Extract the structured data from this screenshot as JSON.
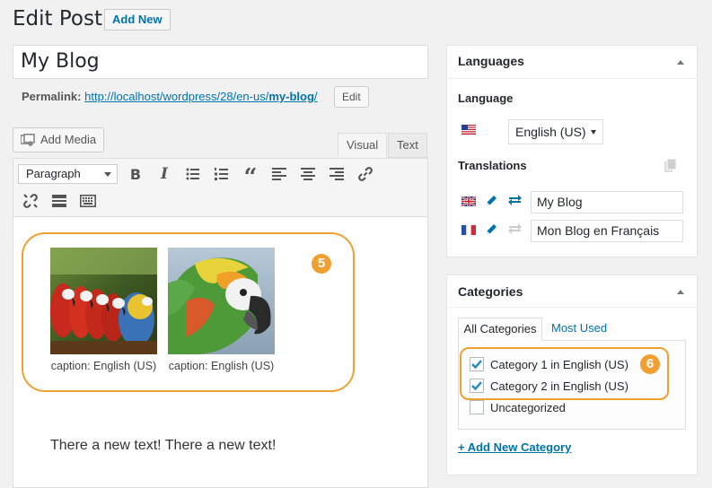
{
  "header": {
    "title": "Edit Post",
    "add_new_label": "Add New"
  },
  "post": {
    "title_value": "My Blog",
    "permalink_label": "Permalink:",
    "permalink_url_prefix": "http://localhost/wordpress/28/en-us/",
    "permalink_slug": "my-blog",
    "permalink_url_suffix": "/",
    "edit_label": "Edit"
  },
  "editor": {
    "add_media_label": "Add Media",
    "tabs": [
      {
        "label": "Visual",
        "active": true
      },
      {
        "label": "Text",
        "active": false
      }
    ],
    "format_select": "Paragraph",
    "toolbar_row1_icons": [
      "bold-icon",
      "italic-icon",
      "bulleted-list-icon",
      "numbered-list-icon",
      "blockquote-icon",
      "align-left-icon",
      "align-center-icon",
      "align-right-icon",
      "insert-link-icon"
    ],
    "toolbar_row2_icons": [
      "remove-link-icon",
      "read-more-icon",
      "toolbar-toggle-icon"
    ],
    "gallery": [
      {
        "caption": "caption: English (US)",
        "image": "parrots-row"
      },
      {
        "caption": "caption: English (US)",
        "image": "macaw-head"
      }
    ],
    "gallery_badge": "5",
    "body_text": "There a new text! There a new text!"
  },
  "languages_panel": {
    "title": "Languages",
    "language_label": "Language",
    "language_value": "English (US)",
    "translations_label": "Translations",
    "translations": [
      {
        "flag": "uk-flag",
        "value": "My Blog",
        "synced": true
      },
      {
        "flag": "fr-flag",
        "value": "Mon Blog en Français",
        "synced": false
      }
    ]
  },
  "categories_panel": {
    "title": "Categories",
    "tab_all": "All Categories",
    "tab_used": "Most Used",
    "badge": "6",
    "items": [
      {
        "label": "Category 1 in English (US)",
        "checked": true
      },
      {
        "label": "Category 2 in English (US)",
        "checked": true
      },
      {
        "label": "Uncategorized",
        "checked": false
      }
    ],
    "add_new_label": "+ Add New Category"
  },
  "colors": {
    "accent": "#0073aa",
    "highlight": "#f0a030",
    "background": "#f1f1f1"
  }
}
